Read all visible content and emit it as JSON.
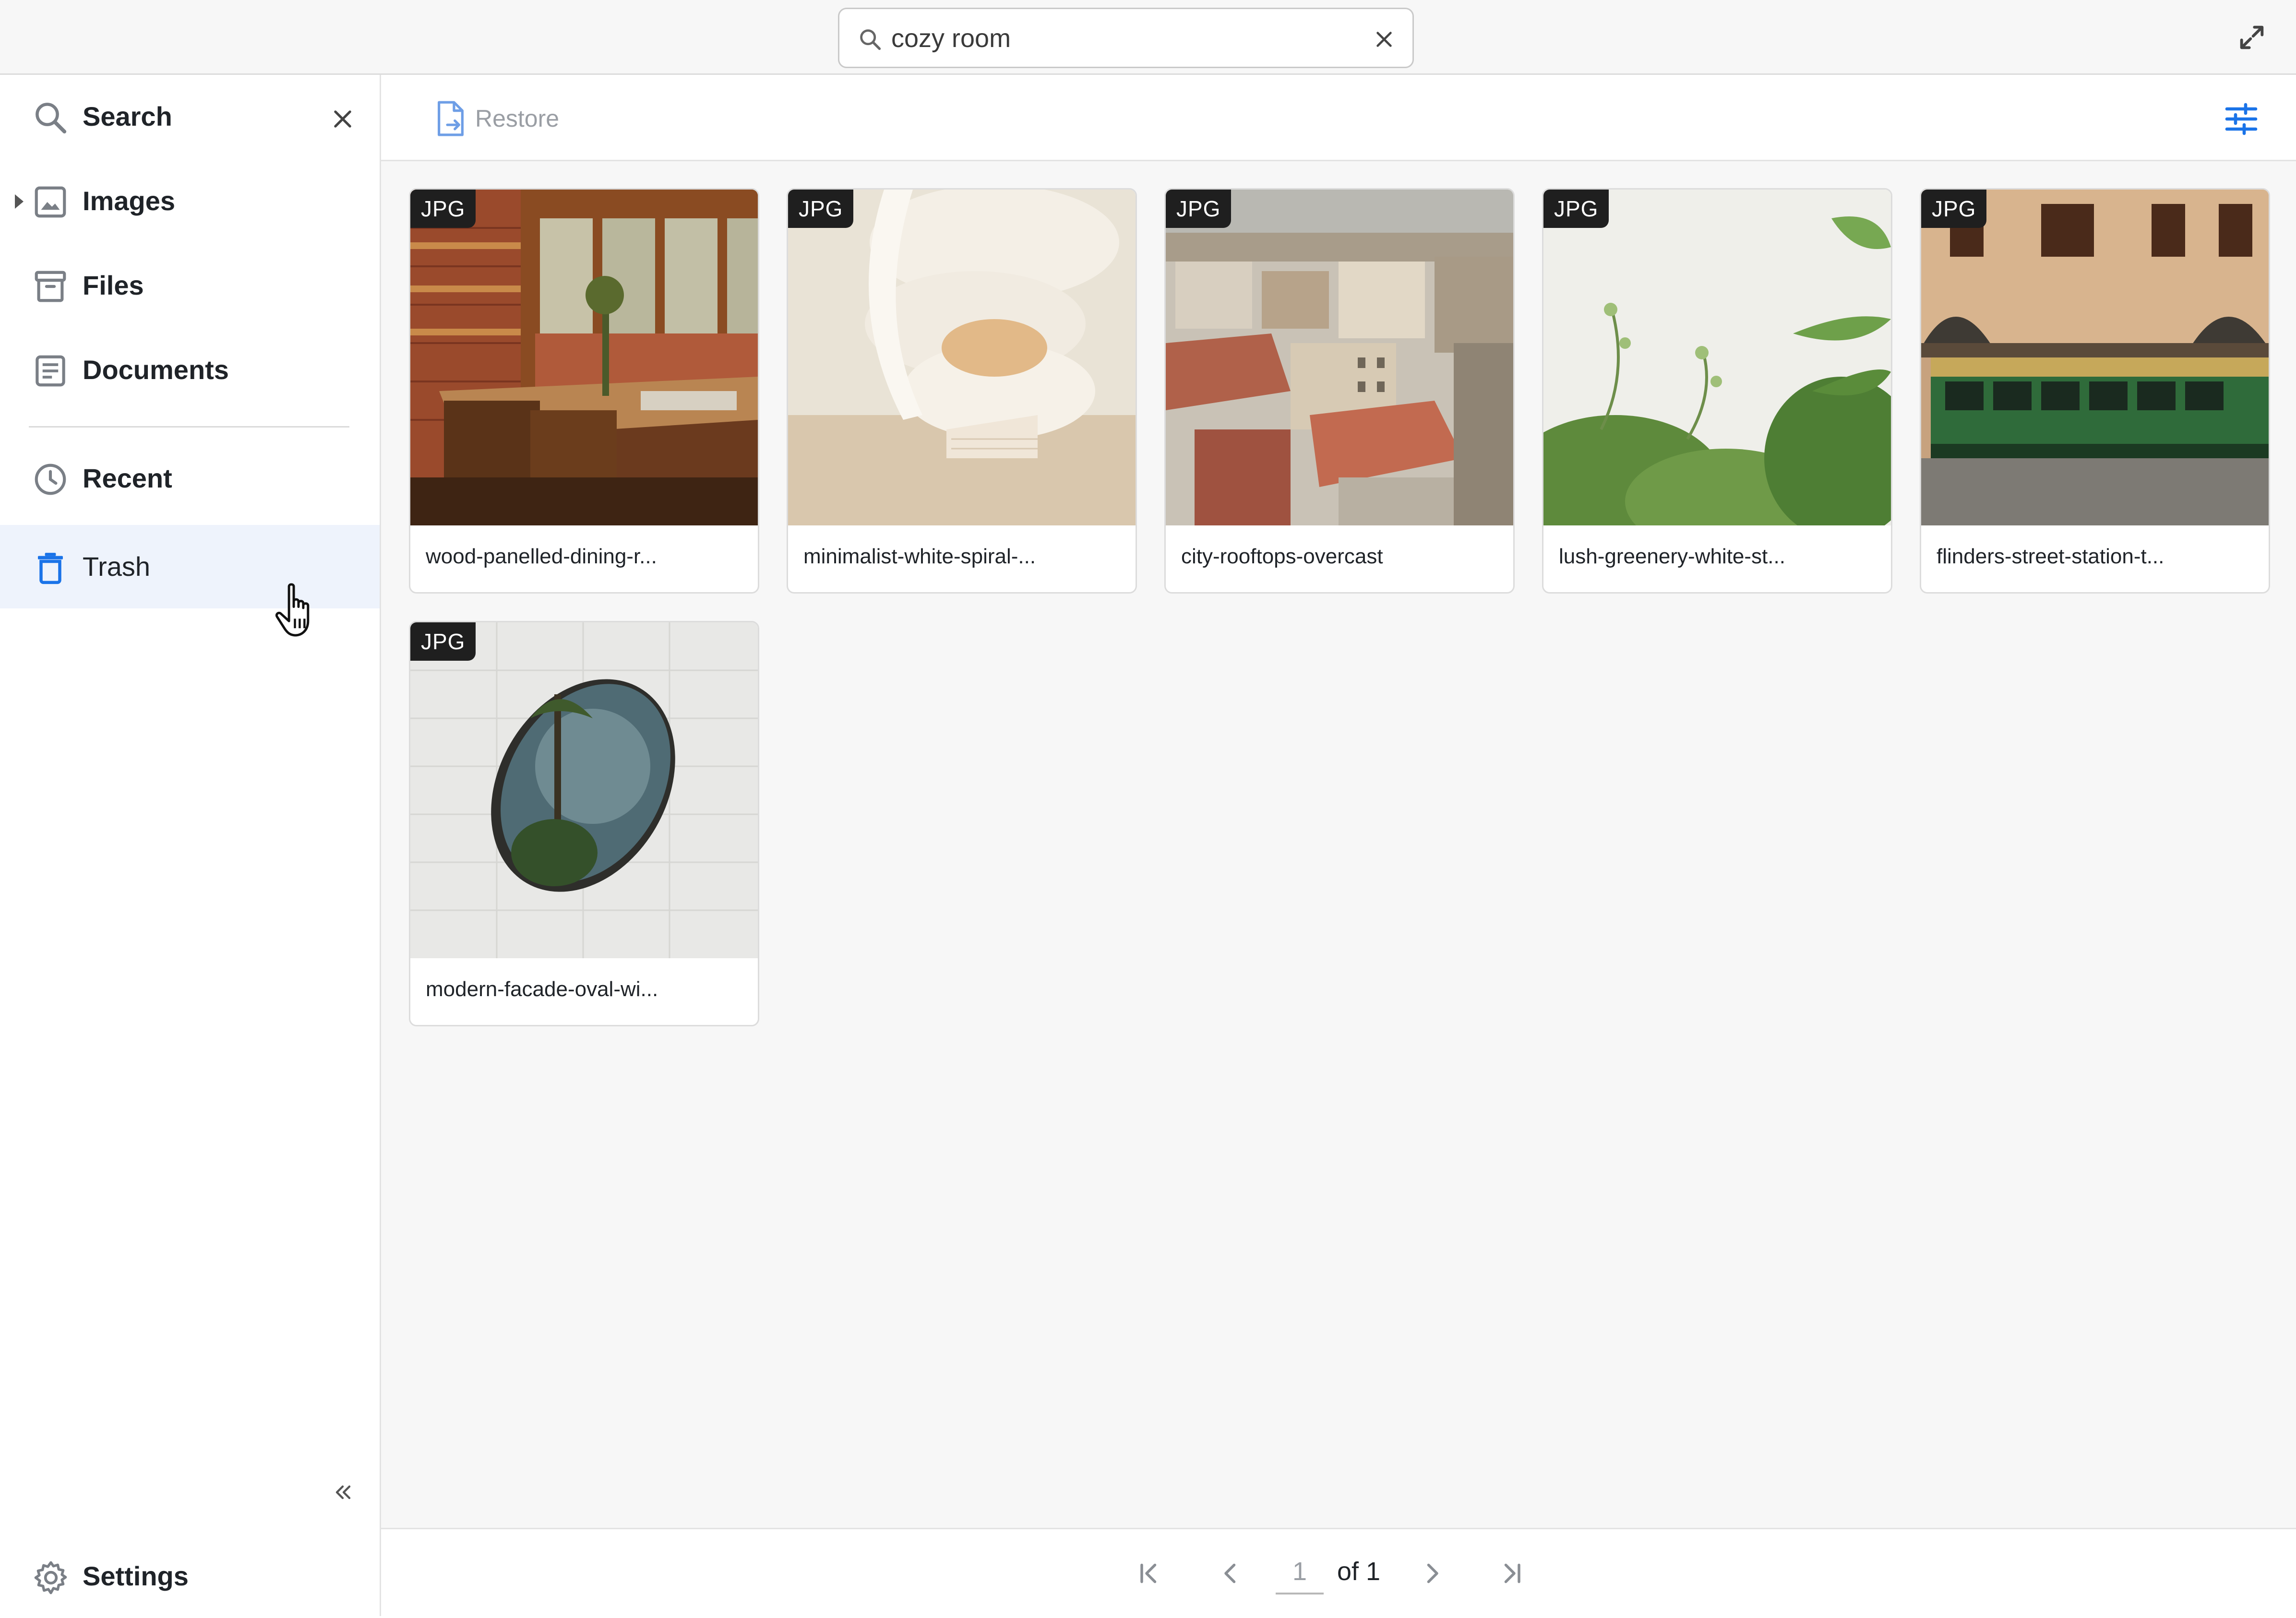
{
  "search": {
    "query": "cozy room"
  },
  "sidebar": {
    "items": [
      {
        "label": "Search",
        "icon": "search-icon"
      },
      {
        "label": "Images",
        "icon": "image-icon"
      },
      {
        "label": "Files",
        "icon": "archive-icon"
      },
      {
        "label": "Documents",
        "icon": "document-icon"
      },
      {
        "label": "Recent",
        "icon": "clock-icon"
      },
      {
        "label": "Trash",
        "icon": "trash-icon",
        "active": true
      }
    ],
    "settings_label": "Settings"
  },
  "toolbar": {
    "restore_label": "Restore"
  },
  "files": [
    {
      "type": "JPG",
      "name": "wood-panelled-dining-r..."
    },
    {
      "type": "JPG",
      "name": "minimalist-white-spiral-..."
    },
    {
      "type": "JPG",
      "name": "city-rooftops-overcast"
    },
    {
      "type": "JPG",
      "name": "lush-greenery-white-st..."
    },
    {
      "type": "JPG",
      "name": "flinders-street-station-t..."
    },
    {
      "type": "JPG",
      "name": "modern-facade-oval-wi..."
    }
  ],
  "pagination": {
    "current": "1",
    "of_label": "of 1"
  },
  "colors": {
    "accent": "#1a73e8",
    "active_bg": "#eef3fc",
    "badge_bg": "#1f1f1f"
  }
}
